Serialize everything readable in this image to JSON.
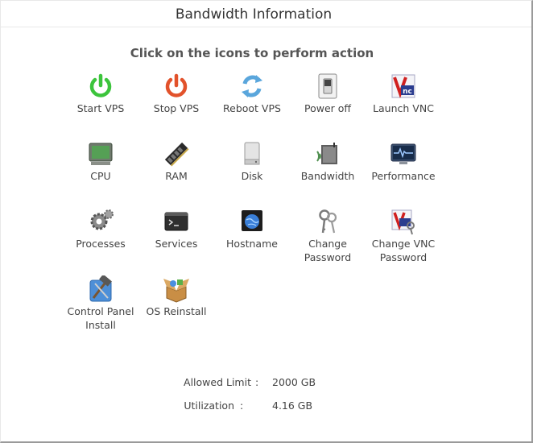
{
  "header": {
    "title": "Bandwidth Information"
  },
  "actions": {
    "heading": "Click on the icons to perform action",
    "items": [
      {
        "id": "start-vps",
        "label": "Start VPS",
        "icon": "power-on-icon",
        "color": "#3cc43c"
      },
      {
        "id": "stop-vps",
        "label": "Stop VPS",
        "icon": "power-off-icon",
        "color": "#e2522b"
      },
      {
        "id": "reboot-vps",
        "label": "Reboot VPS",
        "icon": "refresh-icon",
        "color": "#5aa6dc"
      },
      {
        "id": "power-off",
        "label": "Power off",
        "icon": "switch-icon"
      },
      {
        "id": "launch-vnc",
        "label": "Launch VNC",
        "icon": "vnc-icon"
      },
      {
        "id": "cpu",
        "label": "CPU",
        "icon": "cpu-monitor-icon"
      },
      {
        "id": "ram",
        "label": "RAM",
        "icon": "ram-stick-icon"
      },
      {
        "id": "disk",
        "label": "Disk",
        "icon": "disk-drive-icon"
      },
      {
        "id": "bandwidth",
        "label": "Bandwidth",
        "icon": "wifi-router-icon"
      },
      {
        "id": "performance",
        "label": "Performance",
        "icon": "pulse-monitor-icon"
      },
      {
        "id": "processes",
        "label": "Processes",
        "icon": "gears-icon"
      },
      {
        "id": "services",
        "label": "Services",
        "icon": "terminal-window-icon"
      },
      {
        "id": "hostname",
        "label": "Hostname",
        "icon": "globe-screen-icon"
      },
      {
        "id": "change-password",
        "label": "Change Password",
        "icon": "keys-icon"
      },
      {
        "id": "change-vnc-password",
        "label": "Change VNC Password",
        "icon": "vnc-keys-icon"
      },
      {
        "id": "control-panel-install",
        "label": "Control Panel Install",
        "icon": "hammer-tools-icon"
      },
      {
        "id": "os-reinstall",
        "label": "OS Reinstall",
        "icon": "open-box-icon"
      }
    ]
  },
  "bandwidth": {
    "allowed_label": "Allowed Limit",
    "allowed_value": "2000 GB",
    "util_label": "Utilization",
    "util_value": "4.16 GB",
    "separator": ":"
  }
}
